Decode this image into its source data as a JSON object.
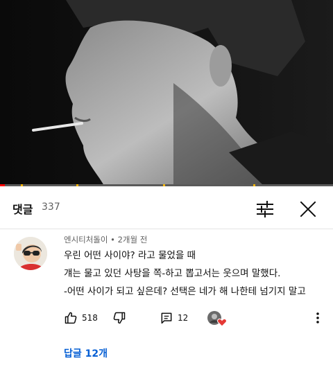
{
  "video": {
    "description_hidden": true,
    "progress_fraction": 0.015,
    "accent_color": "#ff0000",
    "chapter_marker_color": "#f4b400"
  },
  "comments_panel": {
    "title": "댓글",
    "count": "337",
    "sort_icon": "sliders-icon",
    "close_icon": "close-icon"
  },
  "comment": {
    "author": "엔시티처돌이",
    "separator": "•",
    "time": "2개월 전",
    "lines": [
      "우린 어떤 사이야? 라고 물었을 때",
      "걔는 물고 있던 사탕을 쪽-하고 뽑고서는 웃으며 말했다.",
      "-어떤 사이가 되고 싶은데? 선택은 네가 해 나한테 넘기지 말고"
    ],
    "likes": "518",
    "replies_count": "12",
    "replies_link": "답글 12개",
    "heart_color": "#e53935"
  }
}
